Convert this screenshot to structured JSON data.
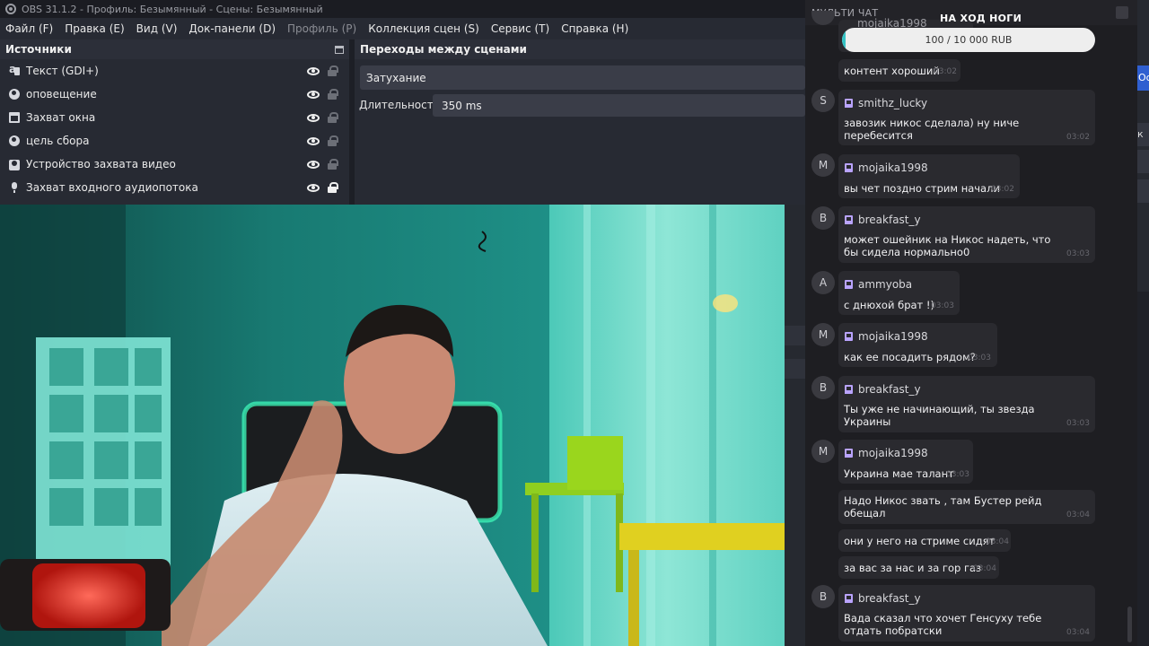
{
  "window": {
    "title": "OBS 31.1.2 - Профиль: Безымянный - Сцены: Безымянный"
  },
  "menu": [
    {
      "label": "Файл (F)",
      "enabled": true
    },
    {
      "label": "Правка (E)",
      "enabled": true
    },
    {
      "label": "Вид (V)",
      "enabled": true
    },
    {
      "label": "Док-панели (D)",
      "enabled": true
    },
    {
      "label": "Профиль (P)",
      "enabled": false
    },
    {
      "label": "Коллекция сцен (S)",
      "enabled": true
    },
    {
      "label": "Сервис (T)",
      "enabled": true
    },
    {
      "label": "Справка (H)",
      "enabled": true
    }
  ],
  "sources": {
    "title": "Источники",
    "items": [
      {
        "label": "Текст (GDI+)",
        "icon": "text-icon",
        "visible": true,
        "locked": false
      },
      {
        "label": "оповещение",
        "icon": "globe-icon",
        "visible": true,
        "locked": false
      },
      {
        "label": "Захват окна",
        "icon": "window-icon",
        "visible": true,
        "locked": false
      },
      {
        "label": "цель сбора",
        "icon": "globe-icon",
        "visible": true,
        "locked": false
      },
      {
        "label": "Устройство захвата видео",
        "icon": "camera-icon",
        "visible": true,
        "locked": false
      },
      {
        "label": "Захват входного аудиопотока",
        "icon": "microphone-icon",
        "visible": true,
        "locked": true
      }
    ]
  },
  "transitions": {
    "title": "Переходы между сценами",
    "selected": "Затухание",
    "duration_label": "Длительность",
    "duration_value": "350 ms"
  },
  "right_strip": {
    "button_fragment": "Ос",
    "button_fragment_2": "к"
  },
  "chat": {
    "header": "МУЛЬТИ ЧАТ",
    "goal": {
      "title": "НА ХОД НОГИ",
      "progress_text": "100 / 10 000 RUB",
      "progress": 0.01,
      "hidden_name": "mojaika1998"
    },
    "messages": [
      {
        "text": "контент хороший",
        "time": "03:02"
      },
      {
        "avatar": "S",
        "user": "smithz_lucky",
        "text": "завозик никос сделала) ну ниче перебесится",
        "time": "03:02"
      },
      {
        "avatar": "M",
        "user": "mojaika1998",
        "text": "вы чет поздно стрим начали",
        "time": "03:02"
      },
      {
        "avatar": "B",
        "user": "breakfast_y",
        "text": "может ошейник на Никос надеть, что бы сидела нормально0",
        "time": "03:03"
      },
      {
        "avatar": "A",
        "user": "ammyoba",
        "text": "с днюхой брат !)",
        "time": "03:03"
      },
      {
        "avatar": "M",
        "user": "mojaika1998",
        "text": "как ее посадить рядом?",
        "time": "03:03"
      },
      {
        "avatar": "B",
        "user": "breakfast_y",
        "text": "Ты уже не начинающий, ты звезда Украины",
        "time": "03:03"
      },
      {
        "avatar": "M",
        "user": "mojaika1998",
        "text": "Украина мае талант",
        "time": "03:03"
      },
      {
        "text": "Надо Никос звать , там Бустер рейд обещал",
        "time": "03:04"
      },
      {
        "text": "они у него на стриме сидят",
        "time": "03:04"
      },
      {
        "text": "за вас за нас и за гор газ",
        "time": "03:04"
      },
      {
        "avatar": "B",
        "user": "breakfast_y",
        "text": "Вада сказал что хочет Генсуху тебе отдать побратски",
        "time": "03:04"
      }
    ]
  },
  "colors": {
    "obs_background": "#272a33",
    "chat_background": "#1e1e22",
    "bubble": "#2a2a2f",
    "goal_fill": "#35c2c4",
    "twitch_purple": "#b9a3ff",
    "webcam_teal": "#1a6a63"
  }
}
